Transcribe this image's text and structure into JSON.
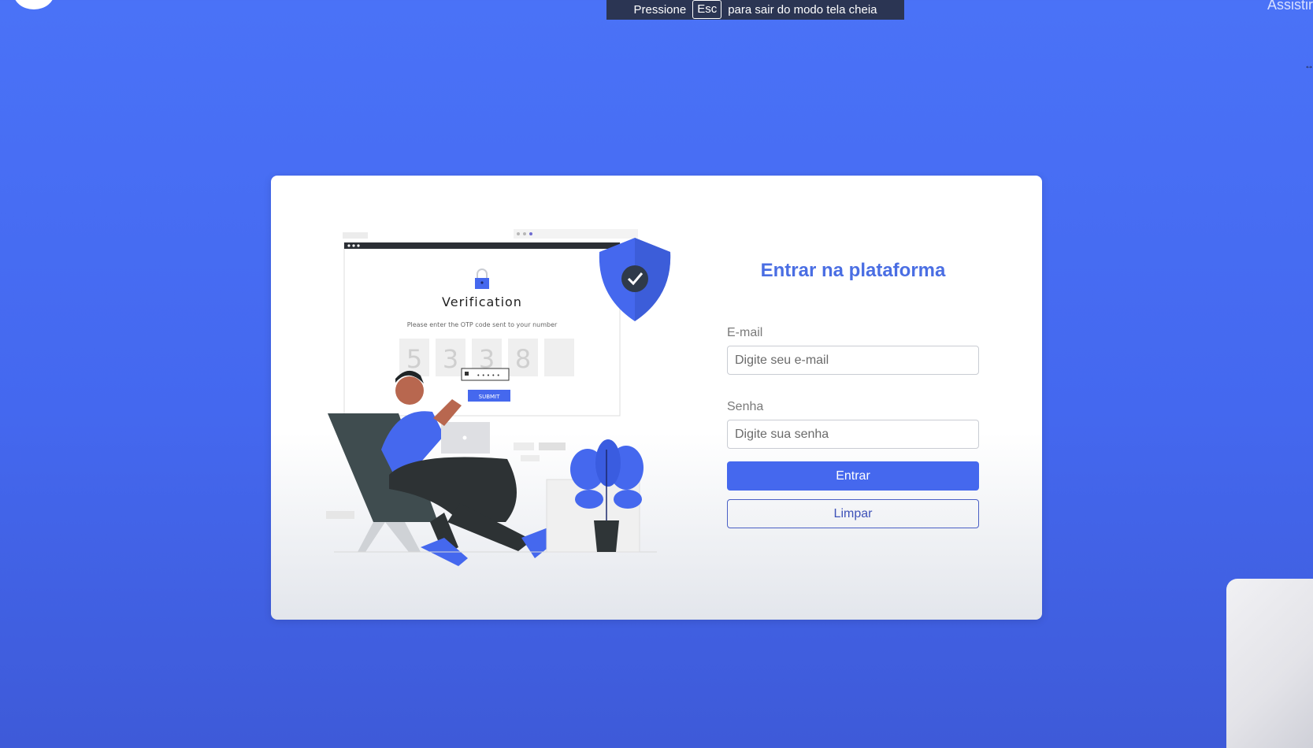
{
  "fullscreen_notice": {
    "prefix": "Pressione",
    "key": "Esc",
    "suffix": "para sair do modo tela cheia"
  },
  "top_right_text": "Assistir",
  "illustration": {
    "window_title": "Verification",
    "window_subtitle": "Please enter the OTP code sent to your number",
    "otp_digits": [
      "5",
      "3",
      "3",
      "8",
      ""
    ],
    "password_mask": "• • • • •",
    "submit_label": "SUBMIT"
  },
  "login_form": {
    "title": "Entrar na plataforma",
    "email_label": "E-mail",
    "email_placeholder": "Digite seu e-mail",
    "password_label": "Senha",
    "password_placeholder": "Digite sua senha",
    "submit_button": "Entrar",
    "clear_button": "Limpar"
  },
  "colors": {
    "background": "#4a72f7",
    "accent": "#4568ee",
    "title": "#4a6ee3"
  }
}
